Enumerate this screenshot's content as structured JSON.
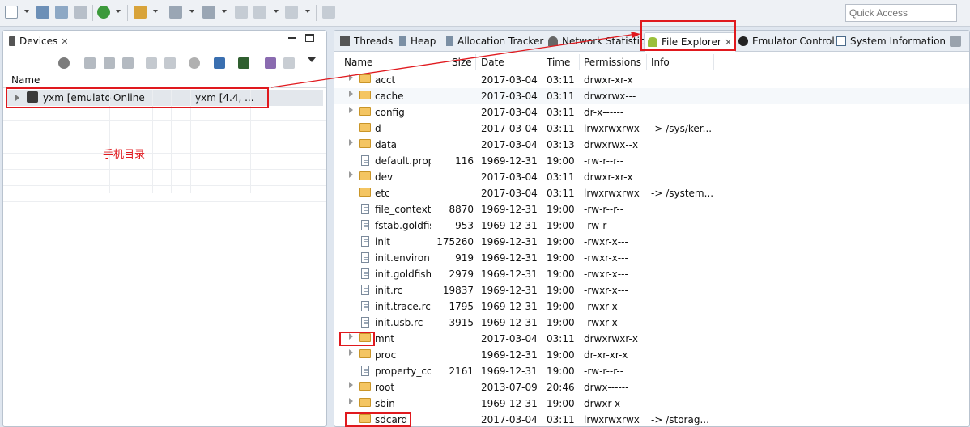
{
  "quick_access": {
    "placeholder": "Quick Access"
  },
  "devices_panel": {
    "tab_label": "Devices",
    "column_header": "Name",
    "device": {
      "name": "yxm [emulator",
      "state": "Online",
      "target": "yxm [4.4, ..."
    },
    "annotation": "手机目录"
  },
  "right_tabs": [
    {
      "label": "Threads",
      "icon": "threads-icon"
    },
    {
      "label": "Heap",
      "icon": "heap-icon"
    },
    {
      "label": "Allocation Tracker",
      "icon": "allocation-tracker-icon"
    },
    {
      "label": "Network Statistics",
      "icon": "network-statistics-icon"
    },
    {
      "label": "File Explorer",
      "icon": "android-icon"
    },
    {
      "label": "Emulator Control",
      "icon": "emulator-control-icon"
    },
    {
      "label": "System Information",
      "icon": "system-information-icon"
    }
  ],
  "file_explorer": {
    "columns": [
      "Name",
      "Size",
      "Date",
      "Time",
      "Permissions",
      "Info"
    ],
    "rows": [
      {
        "name": "acct",
        "type": "folder",
        "expand": true,
        "size": "",
        "date": "2017-03-04",
        "time": "03:11",
        "perm": "drwxr-xr-x",
        "info": ""
      },
      {
        "name": "cache",
        "type": "folder",
        "expand": true,
        "size": "",
        "date": "2017-03-04",
        "time": "03:11",
        "perm": "drwxrwx---",
        "info": ""
      },
      {
        "name": "config",
        "type": "folder",
        "expand": true,
        "size": "",
        "date": "2017-03-04",
        "time": "03:11",
        "perm": "dr-x------",
        "info": ""
      },
      {
        "name": "d",
        "type": "folder",
        "expand": false,
        "size": "",
        "date": "2017-03-04",
        "time": "03:11",
        "perm": "lrwxrwxrwx",
        "info": "-> /sys/ker..."
      },
      {
        "name": "data",
        "type": "folder",
        "expand": true,
        "size": "",
        "date": "2017-03-04",
        "time": "03:13",
        "perm": "drwxrwx--x",
        "info": ""
      },
      {
        "name": "default.prop",
        "type": "file",
        "expand": false,
        "size": "116",
        "date": "1969-12-31",
        "time": "19:00",
        "perm": "-rw-r--r--",
        "info": ""
      },
      {
        "name": "dev",
        "type": "folder",
        "expand": true,
        "size": "",
        "date": "2017-03-04",
        "time": "03:11",
        "perm": "drwxr-xr-x",
        "info": ""
      },
      {
        "name": "etc",
        "type": "folder",
        "expand": false,
        "size": "",
        "date": "2017-03-04",
        "time": "03:11",
        "perm": "lrwxrwxrwx",
        "info": "-> /system..."
      },
      {
        "name": "file_contexts",
        "type": "file",
        "expand": false,
        "size": "8870",
        "date": "1969-12-31",
        "time": "19:00",
        "perm": "-rw-r--r--",
        "info": ""
      },
      {
        "name": "fstab.goldfish",
        "type": "file",
        "expand": false,
        "size": "953",
        "date": "1969-12-31",
        "time": "19:00",
        "perm": "-rw-r-----",
        "info": ""
      },
      {
        "name": "init",
        "type": "file",
        "expand": false,
        "size": "175260",
        "date": "1969-12-31",
        "time": "19:00",
        "perm": "-rwxr-x---",
        "info": ""
      },
      {
        "name": "init.environ.rc",
        "type": "file",
        "expand": false,
        "size": "919",
        "date": "1969-12-31",
        "time": "19:00",
        "perm": "-rwxr-x---",
        "info": ""
      },
      {
        "name": "init.goldfish.rc",
        "type": "file",
        "expand": false,
        "size": "2979",
        "date": "1969-12-31",
        "time": "19:00",
        "perm": "-rwxr-x---",
        "info": ""
      },
      {
        "name": "init.rc",
        "type": "file",
        "expand": false,
        "size": "19837",
        "date": "1969-12-31",
        "time": "19:00",
        "perm": "-rwxr-x---",
        "info": ""
      },
      {
        "name": "init.trace.rc",
        "type": "file",
        "expand": false,
        "size": "1795",
        "date": "1969-12-31",
        "time": "19:00",
        "perm": "-rwxr-x---",
        "info": ""
      },
      {
        "name": "init.usb.rc",
        "type": "file",
        "expand": false,
        "size": "3915",
        "date": "1969-12-31",
        "time": "19:00",
        "perm": "-rwxr-x---",
        "info": ""
      },
      {
        "name": "mnt",
        "type": "folder",
        "expand": true,
        "size": "",
        "date": "2017-03-04",
        "time": "03:11",
        "perm": "drwxrwxr-x",
        "info": ""
      },
      {
        "name": "proc",
        "type": "folder",
        "expand": true,
        "size": "",
        "date": "1969-12-31",
        "time": "19:00",
        "perm": "dr-xr-xr-x",
        "info": ""
      },
      {
        "name": "property_contexts",
        "type": "file",
        "expand": false,
        "size": "2161",
        "date": "1969-12-31",
        "time": "19:00",
        "perm": "-rw-r--r--",
        "info": ""
      },
      {
        "name": "root",
        "type": "folder",
        "expand": true,
        "size": "",
        "date": "2013-07-09",
        "time": "20:46",
        "perm": "drwx------",
        "info": ""
      },
      {
        "name": "sbin",
        "type": "folder",
        "expand": true,
        "size": "",
        "date": "1969-12-31",
        "time": "19:00",
        "perm": "drwxr-x---",
        "info": ""
      },
      {
        "name": "sdcard",
        "type": "folder",
        "expand": false,
        "size": "",
        "date": "2017-03-04",
        "time": "03:11",
        "perm": "lrwxrwxrwx",
        "info": "-> /storag..."
      }
    ]
  },
  "colors": {
    "annotation_red": "#e0191e",
    "folder": "#f4c562",
    "selected_row": "#e3e7ec"
  }
}
